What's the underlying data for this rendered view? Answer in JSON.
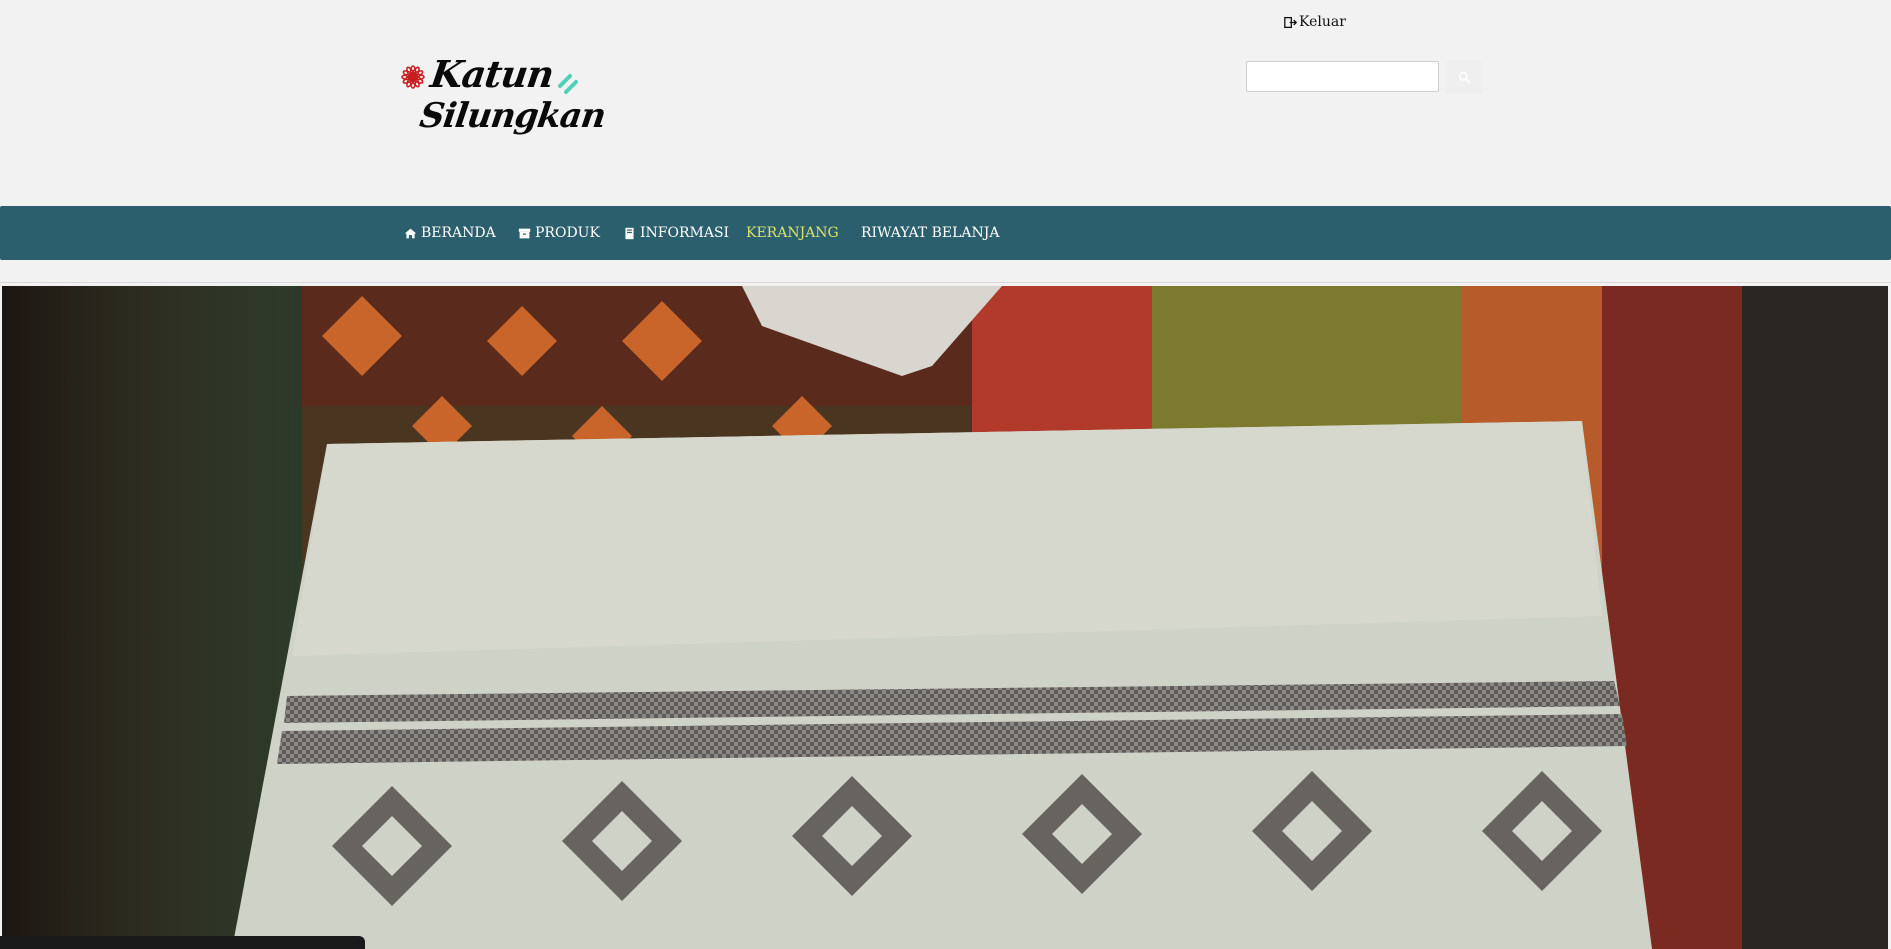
{
  "header": {
    "logout_label": "Keluar",
    "logo": {
      "line1": "Katun",
      "line2": "Silungkan"
    },
    "search": {
      "value": "",
      "placeholder": ""
    }
  },
  "nav": {
    "items": [
      {
        "label": "BERANDA",
        "icon": "home-icon"
      },
      {
        "label": "PRODUK",
        "icon": "box-icon"
      },
      {
        "label": "INFORMASI",
        "icon": "book-icon"
      },
      {
        "label": "KERANJANG",
        "icon": "",
        "active": true
      },
      {
        "label": "RIWAYAT BELANJA",
        "icon": ""
      }
    ]
  },
  "colors": {
    "navbar_bg": "#2b5f6e",
    "nav_active": "#d8e36a",
    "header_bg": "#f2f2f2",
    "logo_accent_red": "#c81e1e",
    "logo_accent_teal": "#4fd1b8"
  },
  "hero": {
    "subject": "woven-songket-cloth-image"
  }
}
